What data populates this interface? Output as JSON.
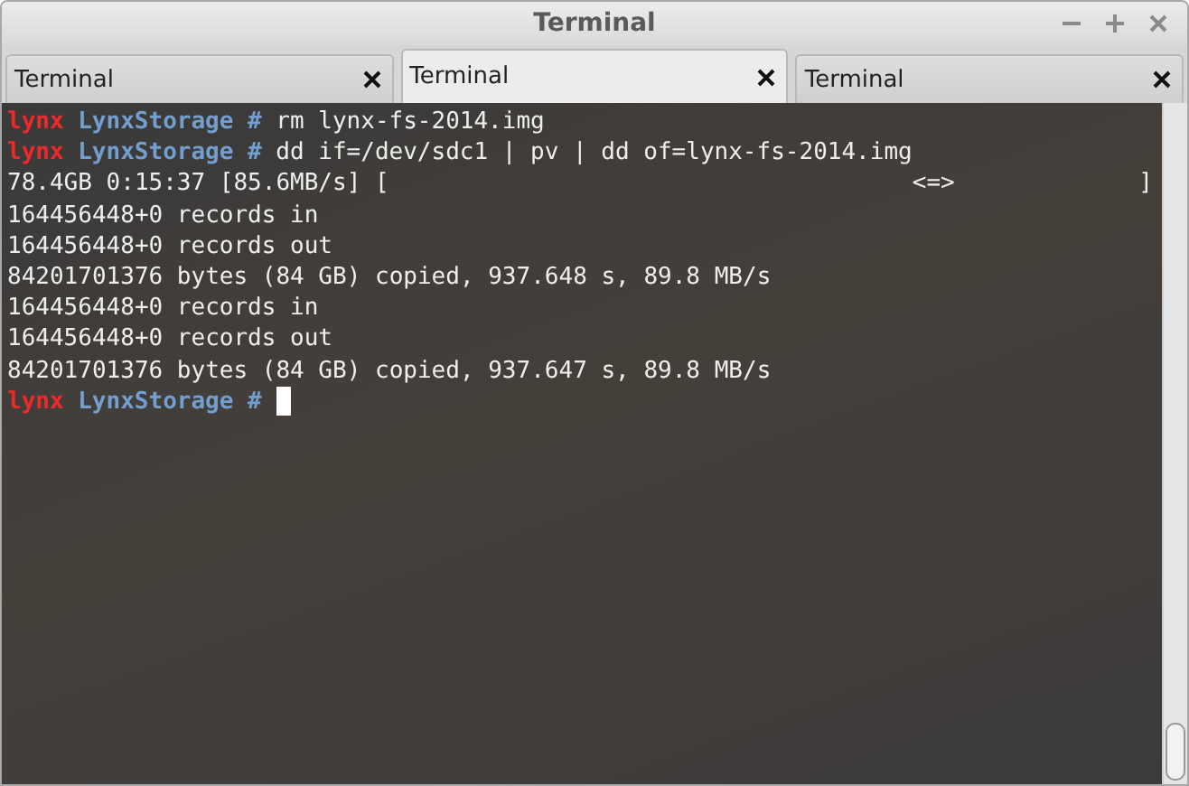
{
  "window": {
    "title": "Terminal"
  },
  "tabs": [
    {
      "label": "Terminal",
      "selected": false
    },
    {
      "label": "Terminal",
      "selected": true
    },
    {
      "label": "Terminal",
      "selected": false
    }
  ],
  "terminal": {
    "lines": [
      [
        {
          "kind": "user",
          "text": "lynx"
        },
        {
          "kind": "host",
          "text": "LynxStorage #"
        },
        {
          "kind": "text",
          "text": "rm lynx-fs-2014.img"
        }
      ],
      [
        {
          "kind": "user",
          "text": "lynx"
        },
        {
          "kind": "host",
          "text": "LynxStorage #"
        },
        {
          "kind": "text",
          "text": "dd if=/dev/sdc1 | pv | dd of=lynx-fs-2014.img"
        }
      ],
      [
        {
          "kind": "text",
          "text": "78.4GB 0:15:37 [85.6MB/s] [                                     <=>             ]"
        }
      ],
      [
        {
          "kind": "text",
          "text": "164456448+0 records in"
        }
      ],
      [
        {
          "kind": "text",
          "text": "164456448+0 records out"
        }
      ],
      [
        {
          "kind": "text",
          "text": "84201701376 bytes (84 GB) copied, 937.648 s, 89.8 MB/s"
        }
      ],
      [
        {
          "kind": "text",
          "text": "164456448+0 records in"
        }
      ],
      [
        {
          "kind": "text",
          "text": "164456448+0 records out"
        }
      ],
      [
        {
          "kind": "text",
          "text": "84201701376 bytes (84 GB) copied, 937.647 s, 89.8 MB/s"
        }
      ],
      [
        {
          "kind": "user",
          "text": "lynx"
        },
        {
          "kind": "host",
          "text": "LynxStorage #"
        },
        {
          "kind": "cursor"
        }
      ]
    ]
  }
}
